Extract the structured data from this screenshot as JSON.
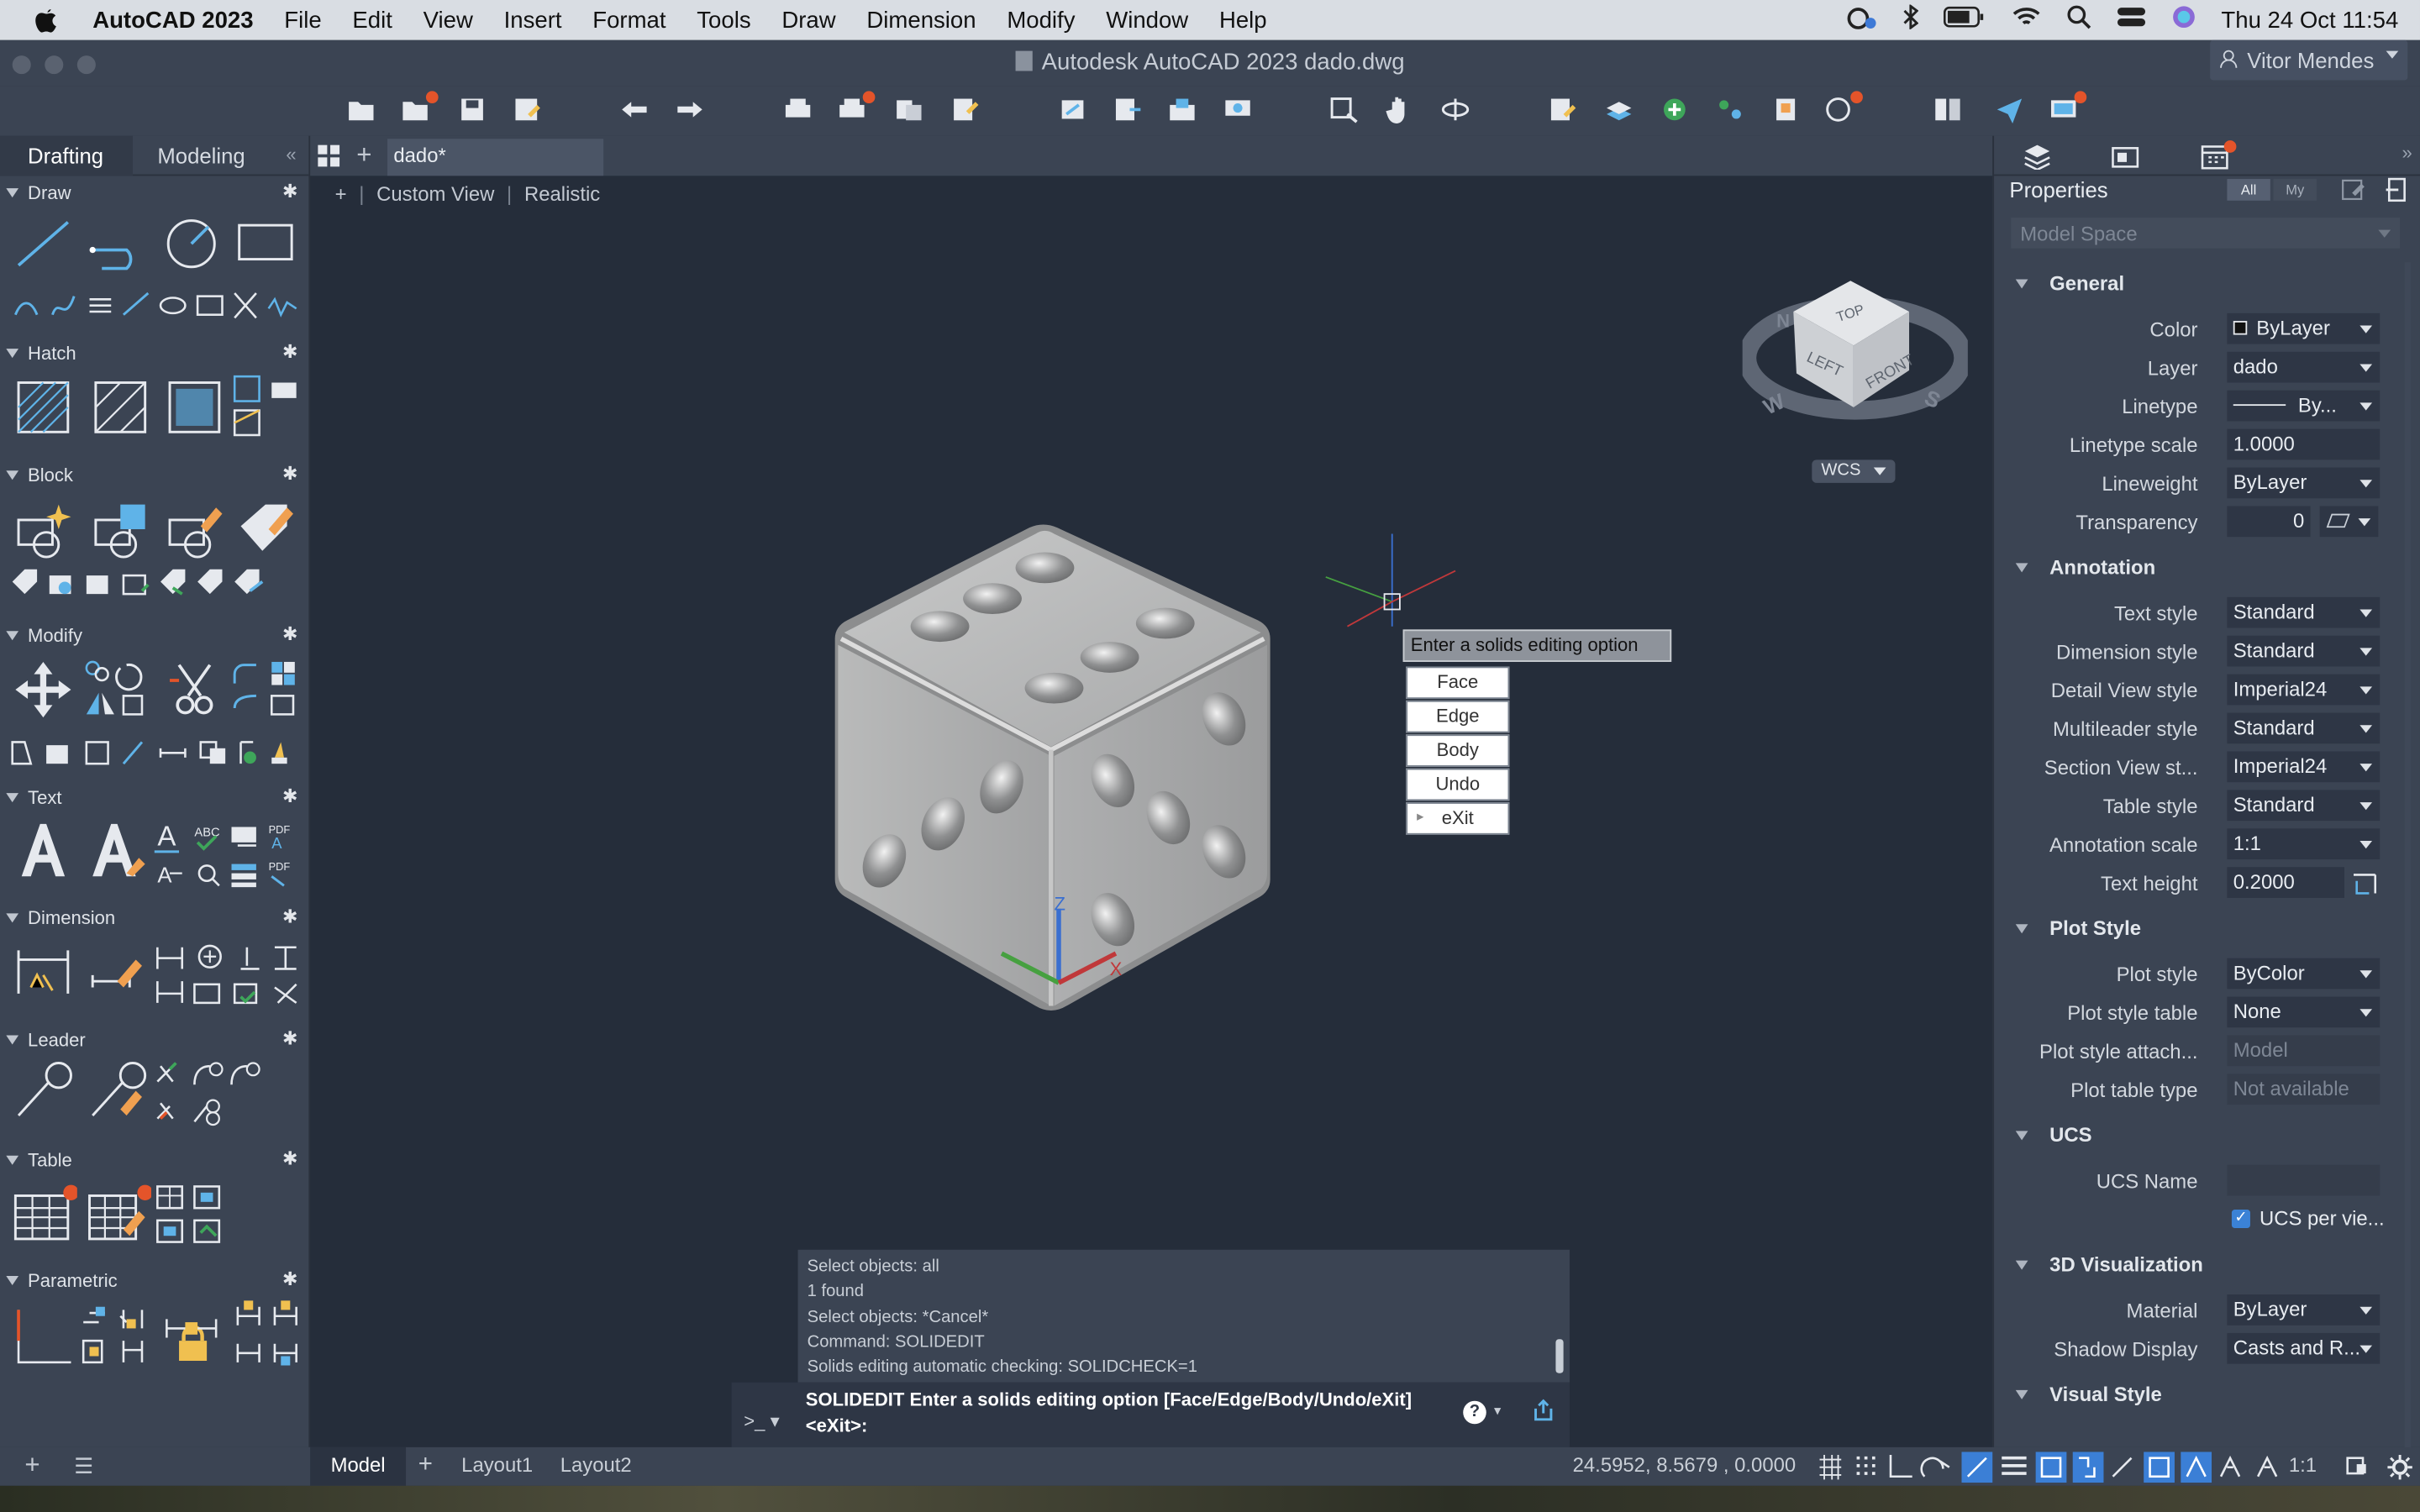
{
  "menubar": {
    "app_name": "AutoCAD 2023",
    "items": [
      "File",
      "Edit",
      "View",
      "Insert",
      "Format",
      "Tools",
      "Draw",
      "Dimension",
      "Modify",
      "Window",
      "Help"
    ],
    "datetime": "Thu 24 Oct  11:54"
  },
  "window": {
    "title": "Autodesk AutoCAD 2023    dado.dwg",
    "user_name": "Vitor Mendes"
  },
  "palette": {
    "tabs": [
      "Drafting",
      "Modeling"
    ],
    "active_tab": "Drafting",
    "sections": [
      "Draw",
      "Hatch",
      "Block",
      "Modify",
      "Text",
      "Dimension",
      "Leader",
      "Table",
      "Parametric"
    ]
  },
  "document": {
    "tab_label": "dado*",
    "view_name": "Custom View",
    "visual_style": "Realistic",
    "view_prefix": "+"
  },
  "viewcube": {
    "top": "TOP",
    "left": "LEFT",
    "front": "FRONT",
    "west": "W",
    "south": "S",
    "north": "N",
    "ucs_label": "WCS"
  },
  "popup": {
    "tooltip": "Enter a solids editing option",
    "options": [
      "Face",
      "Edge",
      "Body",
      "Undo",
      "eXit"
    ]
  },
  "command": {
    "history": [
      "Select objects: all",
      "1 found",
      "Select objects: *Cancel*",
      "Command: SOLIDEDIT",
      "Solids editing automatic checking:  SOLIDCHECK=1"
    ],
    "current_line1": "SOLIDEDIT Enter a solids editing option [Face/Edge/Body/Undo/eXit]",
    "current_line2": "<eXit>:",
    "prompt_icon": ">_"
  },
  "properties": {
    "title": "Properties",
    "filter_all": "All",
    "filter_my": "My",
    "selection": "Model Space",
    "groups": {
      "general": "General",
      "annotation": "Annotation",
      "plot_style": "Plot Style",
      "ucs": "UCS",
      "viz3d": "3D Visualization",
      "visual_style": "Visual Style"
    },
    "rows": {
      "color": {
        "label": "Color",
        "value": "ByLayer"
      },
      "layer": {
        "label": "Layer",
        "value": "dado"
      },
      "linetype": {
        "label": "Linetype",
        "value": "By..."
      },
      "linetype_scale": {
        "label": "Linetype scale",
        "value": "1.0000"
      },
      "lineweight": {
        "label": "Lineweight",
        "value": "ByLayer"
      },
      "transparency": {
        "label": "Transparency",
        "value": "0"
      },
      "text_style": {
        "label": "Text style",
        "value": "Standard"
      },
      "dimension_style": {
        "label": "Dimension style",
        "value": "Standard"
      },
      "detail_view_style": {
        "label": "Detail View style",
        "value": "Imperial24"
      },
      "multileader_style": {
        "label": "Multileader style",
        "value": "Standard"
      },
      "section_view_style": {
        "label": "Section View st...",
        "value": "Imperial24"
      },
      "table_style": {
        "label": "Table style",
        "value": "Standard"
      },
      "annotation_scale": {
        "label": "Annotation scale",
        "value": "1:1"
      },
      "text_height": {
        "label": "Text height",
        "value": "0.2000"
      },
      "plot_style": {
        "label": "Plot style",
        "value": "ByColor"
      },
      "plot_style_table": {
        "label": "Plot style table",
        "value": "None"
      },
      "plot_style_attach": {
        "label": "Plot style attach...",
        "value": "Model"
      },
      "plot_table_type": {
        "label": "Plot table type",
        "value": "Not available"
      },
      "ucs_name": {
        "label": "UCS Name",
        "value": ""
      },
      "ucs_per_viewport": {
        "label": "UCS per vie...",
        "value": "checked"
      },
      "material": {
        "label": "Material",
        "value": "ByLayer"
      },
      "shadow_display": {
        "label": "Shadow Display",
        "value": "Casts and R..."
      }
    }
  },
  "statusbar": {
    "layouts": [
      "Model",
      "Layout1",
      "Layout2"
    ],
    "active_layout": "Model",
    "coordinates": "24.5952, 8.5679 , 0.0000",
    "scale": "1:1"
  },
  "colors": {
    "accent_dot": "#e4542a",
    "panel_bg": "#3b4453",
    "viewport_bg": "#252d3a",
    "icon_blue": "#5fb3e8"
  }
}
